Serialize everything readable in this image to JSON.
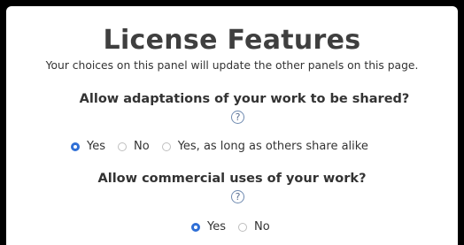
{
  "panel": {
    "title": "License Features",
    "subtitle": "Your choices on this panel will update the other panels on this page."
  },
  "questions": [
    {
      "text": "Allow adaptations of your work to be shared?",
      "help_glyph": "?",
      "help_icon": "question-help-icon",
      "options": [
        {
          "label": "Yes",
          "checked": true
        },
        {
          "label": "No",
          "checked": false
        },
        {
          "label": "Yes, as long as others share alike",
          "checked": false
        }
      ]
    },
    {
      "text": "Allow commercial uses of your work?",
      "help_glyph": "?",
      "help_icon": "question-help-icon",
      "options": [
        {
          "label": "Yes",
          "checked": true
        },
        {
          "label": "No",
          "checked": false
        }
      ]
    }
  ],
  "colors": {
    "accent": "#2f6fd6",
    "text": "#333333",
    "background": "#ffffff"
  }
}
